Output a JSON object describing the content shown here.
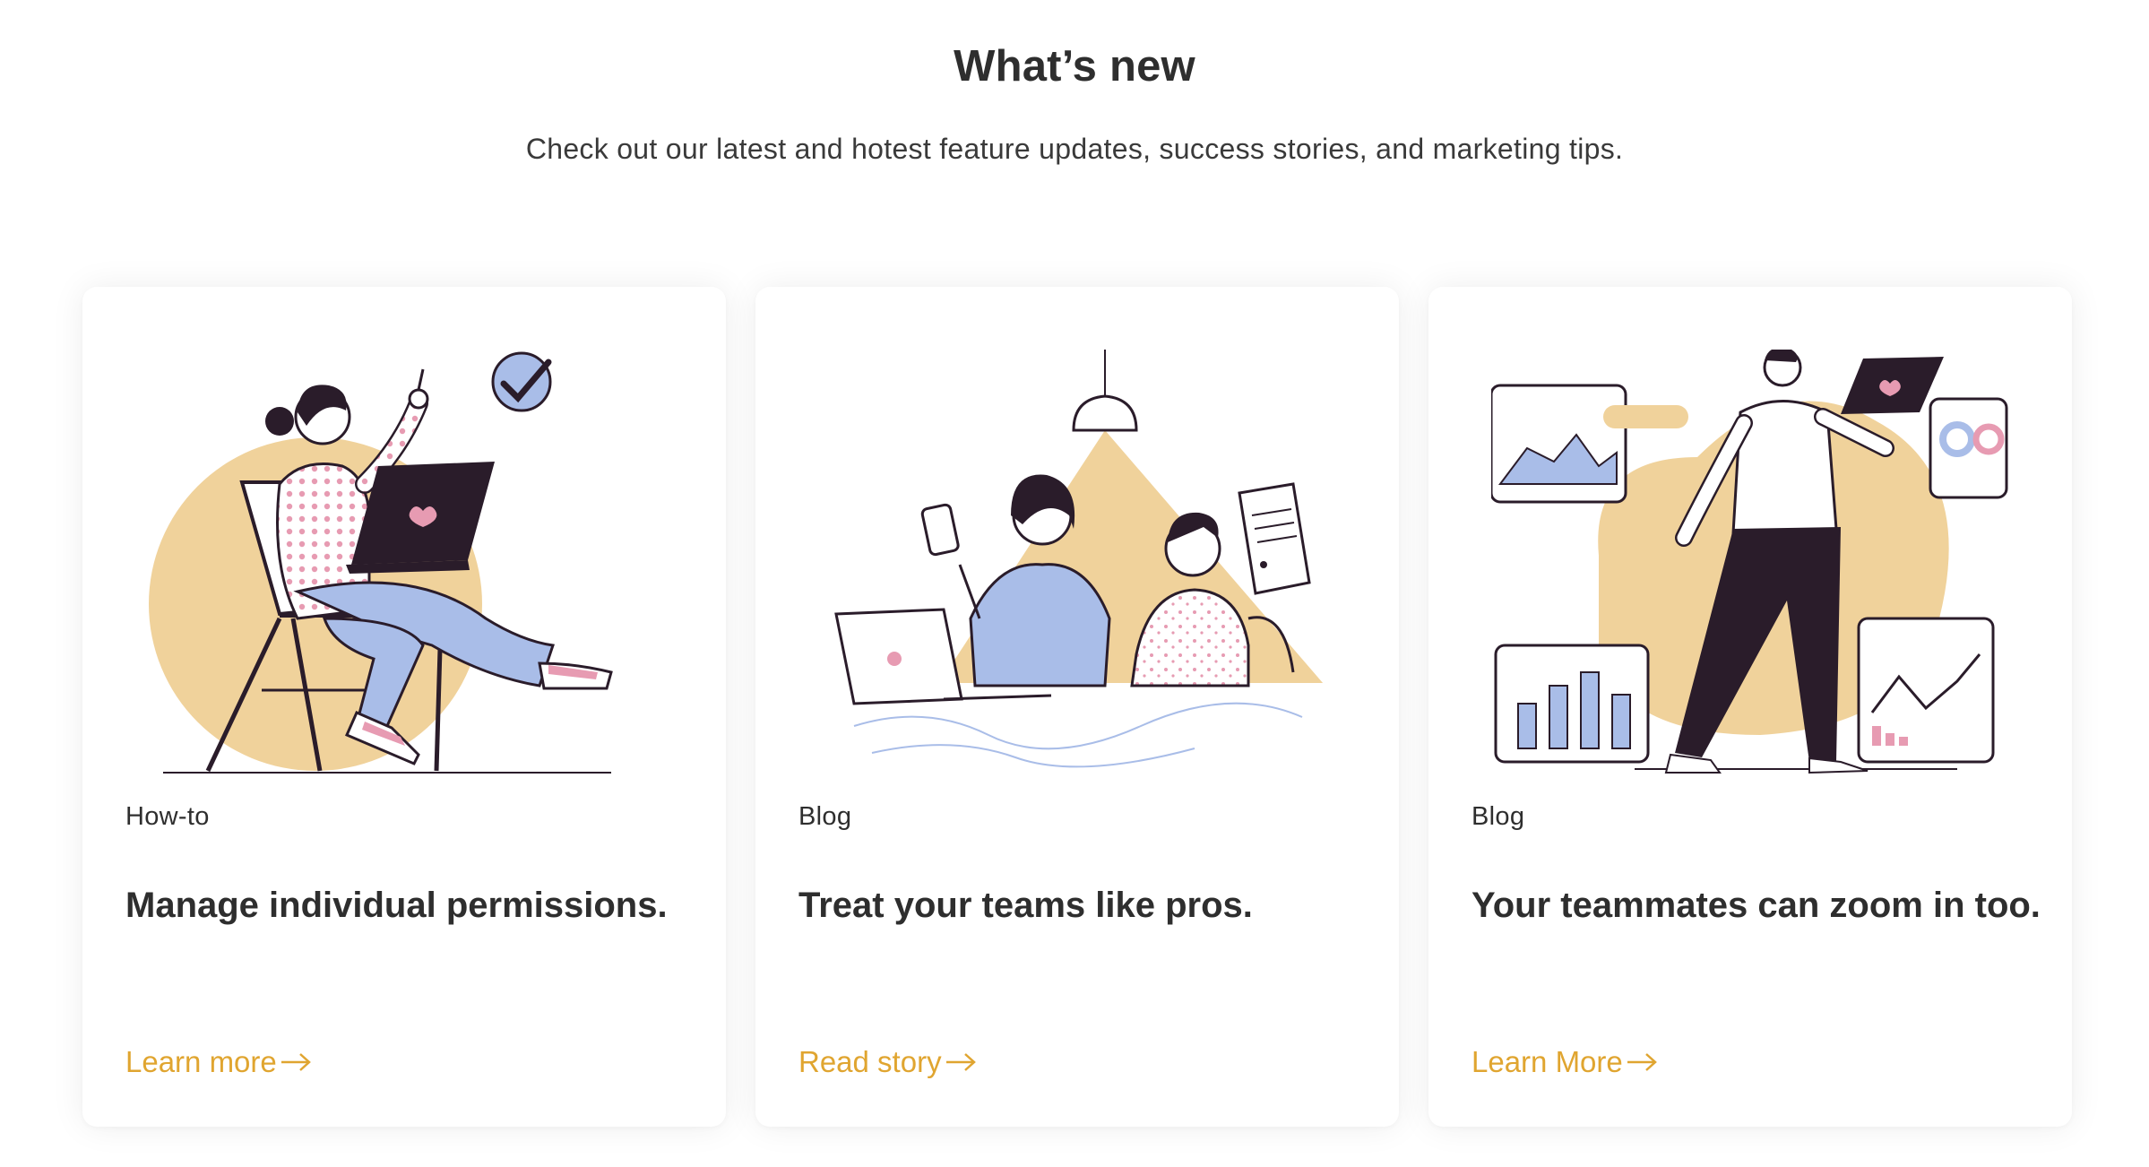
{
  "header": {
    "title": "What’s new",
    "subtitle": "Check out our latest and hotest feature updates, success stories, and marketing tips."
  },
  "colors": {
    "accent": "#e0a530",
    "illustration_sand": "#f0d29b",
    "illustration_blue": "#a9bde8",
    "illustration_pink": "#e79bb2",
    "illustration_dark": "#2a1c2a"
  },
  "cards": [
    {
      "category": "How-to",
      "title": "Manage individual permissions.",
      "cta": "Learn more",
      "icon": "arrow-right-icon",
      "illustration": "woman-laptop-checkmark-illustration"
    },
    {
      "category": "Blog",
      "title": "Treat your teams like pros.",
      "cta": "Read story",
      "icon": "arrow-right-icon",
      "illustration": "team-desk-lamp-illustration"
    },
    {
      "category": "Blog",
      "title": "Your teammates can zoom in too.",
      "cta": "Learn More",
      "icon": "arrow-right-icon",
      "illustration": "man-dashboard-charts-illustration"
    }
  ]
}
